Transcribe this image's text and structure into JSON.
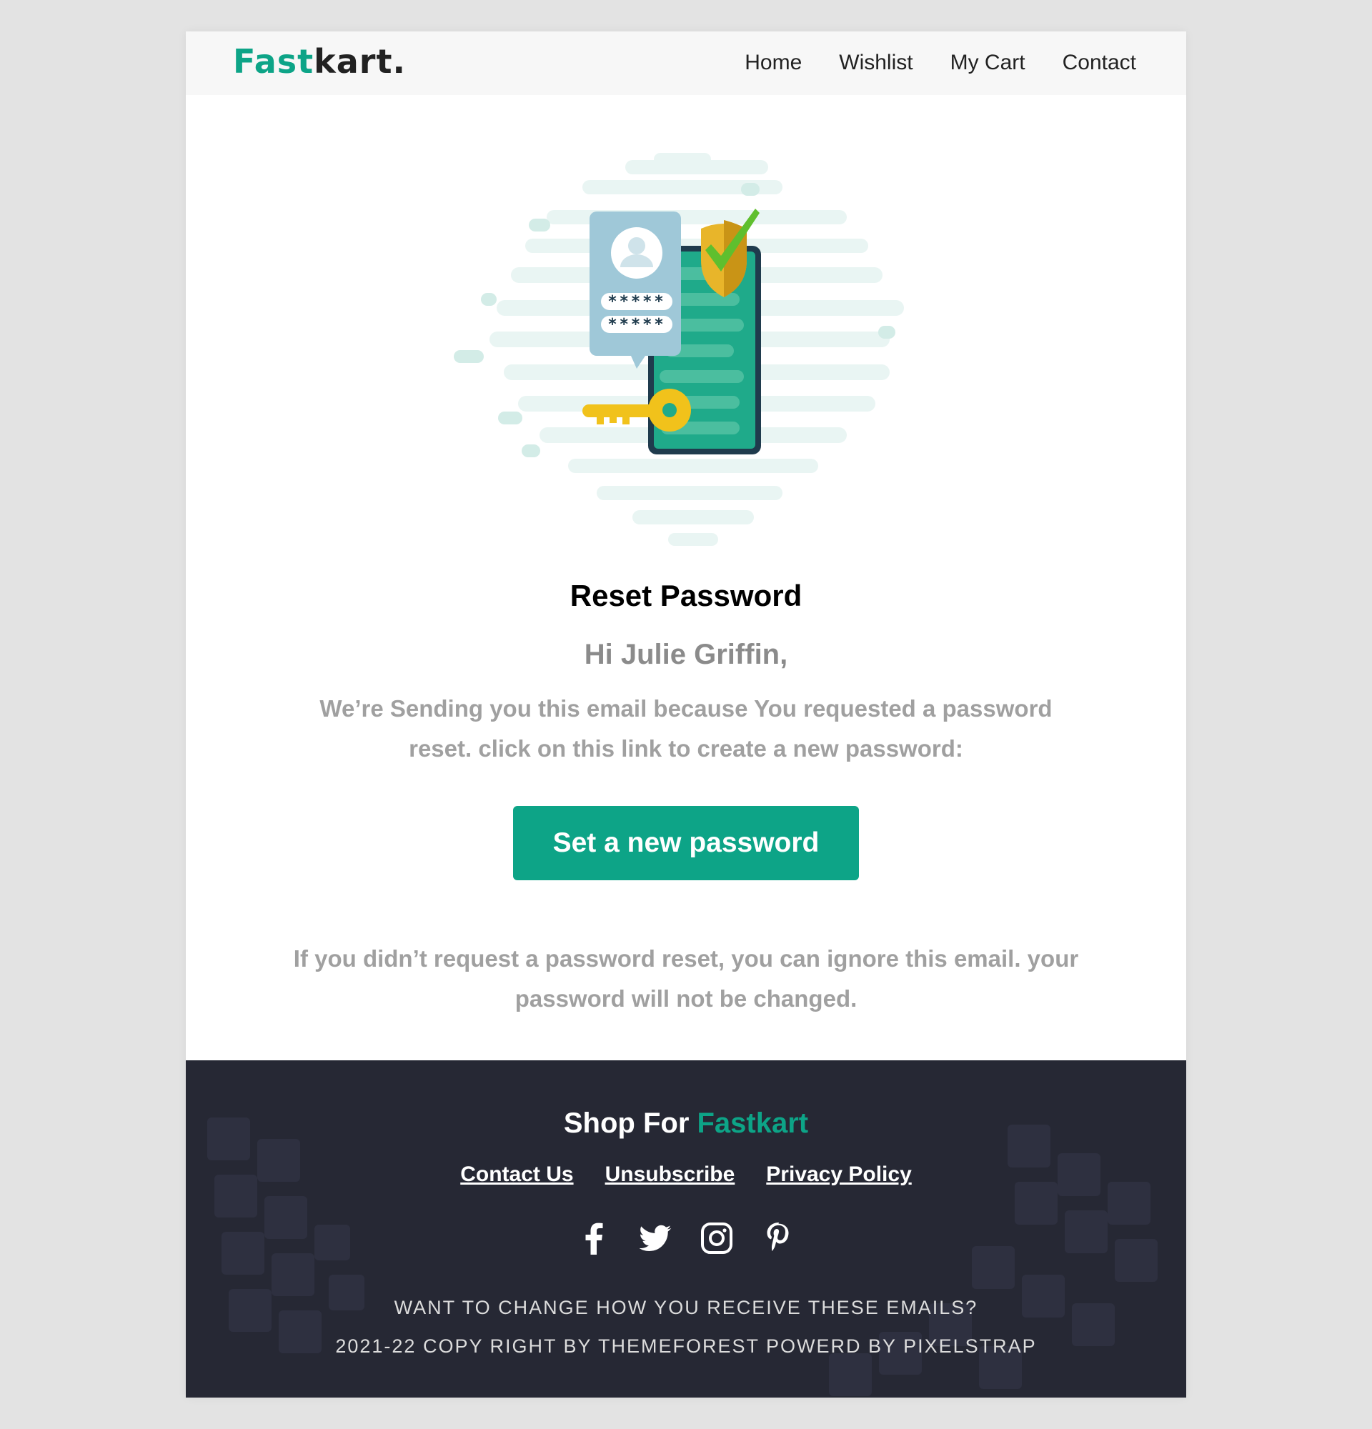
{
  "header": {
    "logo_primary": "Fast",
    "logo_secondary": "kart.",
    "nav": [
      "Home",
      "Wishlist",
      "My Cart",
      "Contact"
    ]
  },
  "hero": {
    "password_mask_1": "*****",
    "password_mask_2": "*****"
  },
  "content": {
    "title": "Reset Password",
    "greeting": "Hi Julie Griffin,",
    "message": "We’re Sending you this email because You requested a password reset. click on this link to create a new password:",
    "button_label": "Set a new password",
    "note": "If you didn’t request a password reset, you can ignore this email. your password will not be changed."
  },
  "footer": {
    "title_prefix": "Shop For ",
    "title_brand": "Fastkart",
    "links": [
      "Contact Us",
      "Unsubscribe",
      "Privacy Policy"
    ],
    "social_icons": [
      "facebook-icon",
      "twitter-icon",
      "instagram-icon",
      "pinterest-icon"
    ],
    "line_1": "WANT TO CHANGE HOW YOU RECEIVE THESE EMAILS?",
    "line_2": "2021-22 COPY RIGHT BY THEMEFOREST POWERD BY PIXELSTRAP"
  },
  "colors": {
    "accent": "#0da487",
    "footer_bg": "#262834",
    "page_bg": "#e3e3e3",
    "header_bg": "#f7f7f7",
    "muted_text": "#a0a0a0"
  }
}
